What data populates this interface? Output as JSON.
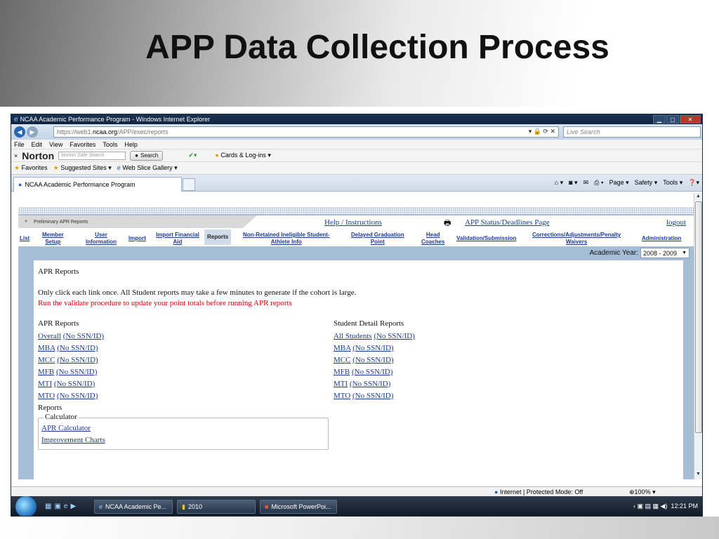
{
  "slide": {
    "title": "APP Data Collection Process"
  },
  "window": {
    "title": "NCAA Academic Performance Program - Windows Internet Explorer",
    "url_prefix": "https://web1.",
    "url_domain": "ncaa.org",
    "url_path": "/APP/exec/reports",
    "live_search_placeholder": "Live Search",
    "menu": [
      "File",
      "Edit",
      "View",
      "Favorites",
      "Tools",
      "Help"
    ],
    "norton": {
      "logo": "Norton",
      "search_placeholder": "Norton Safe Search",
      "search_button": "Search",
      "cards": "Cards & Log-ins"
    },
    "favorites": {
      "label": "Favorites",
      "suggested": "Suggested Sites",
      "web_slice": "Web Slice Gallery"
    },
    "tab_title": "NCAA Academic Performance Program",
    "commands": {
      "page": "Page",
      "safety": "Safety",
      "tools": "Tools"
    }
  },
  "app": {
    "prelim_tab": "Preliminary APR Reports",
    "links": {
      "help": "Help / Instructions",
      "status": "APP Status/Deadlines Page",
      "logout": "logout"
    },
    "nav": {
      "list": "List",
      "member_setup_1": "Member",
      "member_setup_2": "Setup",
      "user_info_1": "User",
      "user_info_2": "Information",
      "import": "Import",
      "import_fin_1": "Import Financial",
      "import_fin_2": "Aid",
      "reports": "Reports",
      "nonret_1": "Non-Retained Ineligible Student-",
      "nonret_2": "Athlete Info",
      "delayed_1": "Delayed Graduation",
      "delayed_2": "Point",
      "head_1": "Head",
      "head_2": "Coaches",
      "validation": "Validation/Submission",
      "corrections_1": "Corrections/Adjustments/Penalty",
      "corrections_2": "Waivers",
      "administration": "Administration"
    },
    "academic_year_label": "Academic Year:",
    "academic_year_value": "2008 - 2009",
    "heading": "APR Reports",
    "note": "Only click each link once. All Student reports may take a few minutes to generate if the cohort is large.",
    "warning": "Run the validate procedure to update your point totals before running APR reports",
    "apr_col_title": "APR Reports",
    "apr_reports": [
      {
        "name": "Overall",
        "alt": "(No SSN/ID)"
      },
      {
        "name": "MBA",
        "alt": "(No SSN/ID)"
      },
      {
        "name": "MCC",
        "alt": "(No SSN/ID)"
      },
      {
        "name": "MFB",
        "alt": "(No SSN/ID)"
      },
      {
        "name": "MTI",
        "alt": "(No SSN/ID)"
      },
      {
        "name": "MTO",
        "alt": "(No SSN/ID)"
      }
    ],
    "student_col_title": "Student Detail Reports",
    "student_reports": [
      {
        "name": "All Students",
        "alt": "(No SSN/ID)"
      },
      {
        "name": "MBA",
        "alt": "(No SSN/ID)"
      },
      {
        "name": "MCC",
        "alt": "(No SSN/ID)"
      },
      {
        "name": "MFB",
        "alt": "(No SSN/ID)"
      },
      {
        "name": "MTI",
        "alt": "(No SSN/ID)"
      },
      {
        "name": "MTO",
        "alt": "(No SSN/ID)"
      }
    ],
    "reports_label": "Reports",
    "calculator_legend": "Calculator",
    "calc_links": [
      "APR Calculator",
      "Improvement Charts"
    ]
  },
  "status": {
    "zone": "Internet | Protected Mode: Off",
    "zoom": "100%"
  },
  "taskbar": {
    "items": [
      "NCAA Academic Pe...",
      "2010",
      "Microsoft PowerPoi..."
    ],
    "clock": "12:21 PM"
  }
}
